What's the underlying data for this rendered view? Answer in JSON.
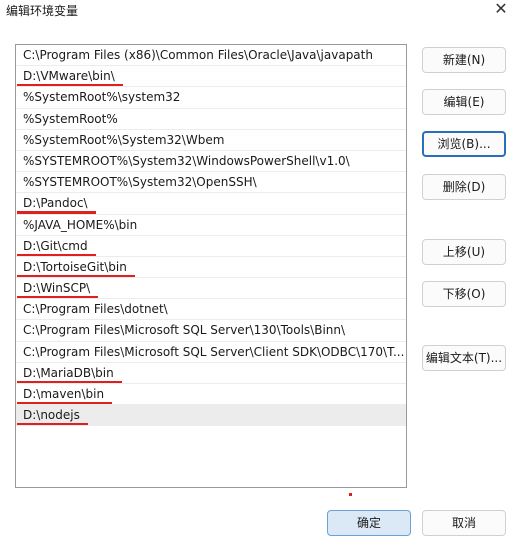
{
  "window": {
    "title": "编辑环境变量",
    "close_glyph": "✕"
  },
  "paths": [
    "C:\\Program Files (x86)\\Common Files\\Oracle\\Java\\javapath",
    "D:\\VMware\\bin\\",
    "%SystemRoot%\\system32",
    "%SystemRoot%",
    "%SystemRoot%\\System32\\Wbem",
    "%SYSTEMROOT%\\System32\\WindowsPowerShell\\v1.0\\",
    "%SYSTEMROOT%\\System32\\OpenSSH\\",
    "D:\\Pandoc\\",
    "%JAVA_HOME%\\bin",
    "D:\\Git\\cmd",
    "D:\\TortoiseGit\\bin",
    "D:\\WinSCP\\",
    "C:\\Program Files\\dotnet\\",
    "C:\\Program Files\\Microsoft SQL Server\\130\\Tools\\Binn\\",
    "C:\\Program Files\\Microsoft SQL Server\\Client SDK\\ODBC\\170\\T...",
    "D:\\MariaDB\\bin",
    "D:\\maven\\bin",
    "D:\\nodejs"
  ],
  "selected_index": 17,
  "underlined_indices": [
    1,
    7,
    9,
    10,
    11,
    15,
    16,
    17
  ],
  "buttons": {
    "new": "新建(N)",
    "edit": "编辑(E)",
    "browse": "浏览(B)...",
    "delete": "删除(D)",
    "move_up": "上移(U)",
    "move_down": "下移(O)",
    "edit_text": "编辑文本(T)..."
  },
  "footer": {
    "ok": "确定",
    "cancel": "取消"
  },
  "colors": {
    "annotation_red": "#e0201c",
    "focus_blue": "#2b6fb8",
    "selected_bg": "#ececec"
  }
}
